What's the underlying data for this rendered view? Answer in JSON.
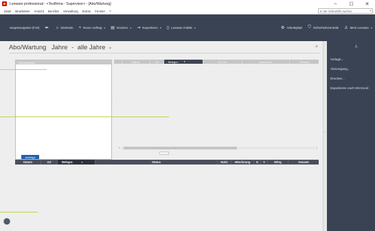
{
  "window": {
    "title": "Lexware professional - <Testfirma - Supervisor> - [Abo/Wartung]",
    "minimize": "–",
    "maximize": "☐",
    "close": "✕"
  },
  "menu": {
    "items": [
      "Datei",
      "Bearbeiten",
      "Ansicht",
      "Berichte",
      "Verwaltung",
      "Extras",
      "Fenster",
      "?"
    ],
    "search_placeholder": "In der Onlinehilfe suchen",
    "search_icon": "⌕"
  },
  "toolbar": {
    "nav_label": "Hauptnavigation (F10)",
    "back_icon": "⬅",
    "items": [
      {
        "icon": "home-icon",
        "glyph": "⌂",
        "label": "Startseite",
        "caret": ""
      },
      {
        "icon": "plus-icon",
        "glyph": "+",
        "label": "Neuer Auftrag",
        "caret": "▾"
      },
      {
        "icon": "printer-icon",
        "glyph": "▤",
        "label": "Drucken",
        "caret": "▾"
      },
      {
        "icon": "export-icon",
        "glyph": "⇥",
        "label": "Exportieren",
        "caret": "▾"
      },
      {
        "icon": "mobile-icon",
        "glyph": "▯",
        "label": "Lexware mobile",
        "caret": "▾"
      }
    ],
    "right_items": [
      {
        "icon": "gear-icon",
        "glyph": "⚙",
        "label": "Arbeitsplatz"
      },
      {
        "icon": "shield-icon",
        "glyph": "⛉",
        "label": "Sicherheitszentrale"
      },
      {
        "icon": "user-icon",
        "glyph": "♙",
        "label": "Mein Lexware",
        "caret": "▾"
      }
    ]
  },
  "page": {
    "title": "Abo/Wartung",
    "year_dropdown": "Jahre",
    "separator": "-",
    "filter_dropdown": "alle Jahre",
    "caret": "▾",
    "close_icon": "×"
  },
  "left_panel": {
    "header": "Abovorgänge"
  },
  "right_grid": {
    "columns": [
      "",
      "Datum",
      "Art",
      "Belegnr.",
      "Kd.-Nr.",
      "Matchcode",
      "Gesamt"
    ],
    "selected_column": "Belegnr.",
    "caret": "▾"
  },
  "scroll": {
    "left": "‹",
    "right": "›"
  },
  "splitter_icon": "⌄",
  "collapse_arrow": "›",
  "bottom": {
    "tab_label": "Aufträge",
    "columns": [
      "Datum",
      "Art",
      "Belegnr.",
      "Status",
      "Notiz",
      "eRechnung",
      "D",
      "V",
      "Witrg",
      "Gesamt"
    ],
    "selected_column": "Belegnr.",
    "caret": "▾"
  },
  "info_icon": "ⓘ",
  "side_handle_icon": "›",
  "action_panel": {
    "pin_icon": "⊥",
    "actions": [
      "Vorlage...",
      "Abovorgang...",
      "Drucken...",
      "Exportieren nach MS Excel"
    ]
  },
  "colors": {
    "toolbar_bg": "#3a4353",
    "content_bg": "#eeeeee",
    "accent_tab": "#1f5fad",
    "leader_line": "#bcd64a",
    "logo": "#c8102e"
  }
}
